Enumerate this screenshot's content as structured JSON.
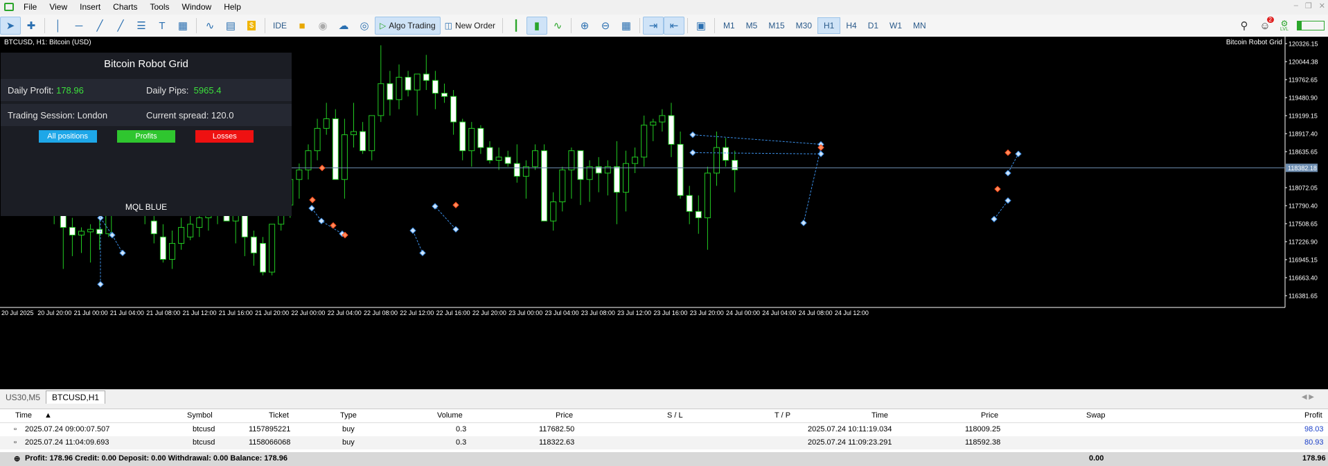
{
  "menu": {
    "items": [
      "File",
      "View",
      "Insert",
      "Charts",
      "Tools",
      "Window",
      "Help"
    ]
  },
  "toolbar": {
    "ide": "IDE",
    "algo": "Algo Trading",
    "new_order": "New Order",
    "timeframes": [
      "M1",
      "M5",
      "M15",
      "M30",
      "H1",
      "H4",
      "D1",
      "W1",
      "MN"
    ],
    "active_tf": "H1",
    "notif_count": "2",
    "lvl": "LVL"
  },
  "chart": {
    "symbol_title": "BTCUSD, H1:  Bitcoin (USD)",
    "robot_label": "Bitcoin Robot Grid",
    "current_price": "118382.18",
    "price_labels": [
      "120326.15",
      "120044.38",
      "119762.65",
      "119480.90",
      "119199.15",
      "118917.40",
      "118635.65",
      "118382.18",
      "118072.05",
      "117790.40",
      "117508.65",
      "117226.90",
      "116945.15",
      "116663.40",
      "116381.65"
    ],
    "time_labels": [
      "20 Jul 2025",
      "20 Jul 20:00",
      "21 Jul 00:00",
      "21 Jul 04:00",
      "21 Jul 08:00",
      "21 Jul 12:00",
      "21 Jul 16:00",
      "21 Jul 20:00",
      "22 Jul 00:00",
      "22 Jul 04:00",
      "22 Jul 08:00",
      "22 Jul 12:00",
      "22 Jul 16:00",
      "22 Jul 20:00",
      "23 Jul 00:00",
      "23 Jul 04:00",
      "23 Jul 08:00",
      "23 Jul 12:00",
      "23 Jul 16:00",
      "23 Jul 20:00",
      "24 Jul 00:00",
      "24 Jul 04:00",
      "24 Jul 08:00",
      "24 Jul 12:00"
    ],
    "colors": {
      "bull": "#000000",
      "bear": "#ffffff",
      "wick": "#22cc22",
      "level": "#6f8fb2"
    }
  },
  "ea_panel": {
    "title": "Bitcoin Robot Grid",
    "daily_profit_label": "Daily Profit:",
    "daily_profit": "178.96",
    "daily_pips_label": "Daily Pips:",
    "daily_pips": "5965.4",
    "session_label": "Trading Session: London",
    "spread_label": "Current spread: 120.0",
    "btn_all": "All positions",
    "btn_profits": "Profits",
    "btn_losses": "Losses",
    "brand": "MQL BLUE",
    "colors": {
      "all": "#1ea7e8",
      "profits": "#2fc62f",
      "losses": "#ee1111"
    }
  },
  "tabs": [
    "US30,M5",
    "BTCUSD,H1"
  ],
  "active_tab": "BTCUSD,H1",
  "trades": {
    "columns": [
      "Time",
      "Symbol",
      "Ticket",
      "Type",
      "Volume",
      "Price",
      "S / L",
      "T / P",
      "Time",
      "Price",
      "Swap",
      "Profit"
    ],
    "rows": [
      [
        "2025.07.24 09:00:07.507",
        "btcusd",
        "1157895221",
        "buy",
        "0.3",
        "117682.50",
        "",
        "",
        "2025.07.24 10:11:19.034",
        "118009.25",
        "",
        "98.03"
      ],
      [
        "2025.07.24 11:04:09.693",
        "btcusd",
        "1158066068",
        "buy",
        "0.3",
        "118322.63",
        "",
        "",
        "2025.07.24 11:09:23.291",
        "118592.38",
        "",
        "80.93"
      ]
    ],
    "summary": "Profit: 178.96  Credit: 0.00  Deposit: 0.00  Withdrawal: 0.00  Balance: 178.96",
    "swap_total": "0.00",
    "profit_total": "178.96"
  }
}
